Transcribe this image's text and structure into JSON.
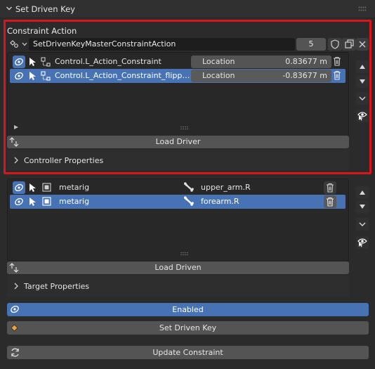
{
  "panel": {
    "title": "Set Driven Key"
  },
  "constraint_action": {
    "label": "Constraint Action",
    "action_name": "SetDrivenKeyMasterConstraintAction",
    "users": "5",
    "rows": [
      {
        "name": "Control.L_Action_Constraint",
        "property": "Location",
        "value": "0.83677 m",
        "selected": false
      },
      {
        "name": "Control.L_Action_Constraint_flipp…",
        "property": "Location",
        "value": "-0.83677 m",
        "selected": true
      }
    ],
    "load_driver_label": "Load Driver",
    "controller_properties_label": "Controller Properties"
  },
  "driven": {
    "rows": [
      {
        "object": "metarig",
        "bone": "upper_arm.R",
        "selected": false
      },
      {
        "object": "metarig",
        "bone": "forearm.R",
        "selected": true
      }
    ],
    "load_driven_label": "Load Driven",
    "target_properties_label": "Target Properties"
  },
  "footer": {
    "enabled_label": "Enabled",
    "set_driven_key_label": "Set Driven Key",
    "update_constraint_label": "Update Constraint"
  },
  "colors": {
    "accent": "#4772b3",
    "highlight_border": "#d8161c",
    "keyframe": "#e8a23c"
  }
}
